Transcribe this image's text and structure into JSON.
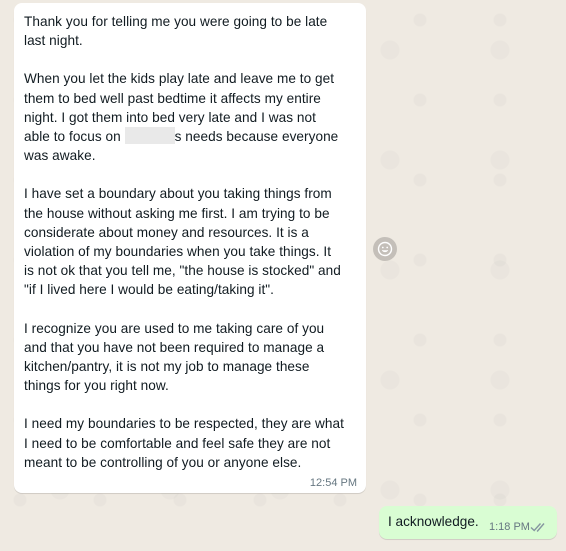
{
  "incoming_message": {
    "paragraphs": [
      "Thank you for telling me you were going to be late\nlast night.",
      "When you let the kids play late and leave me to get\nthem to bed well past bedtime it affects my entire\nnight.  I got them into bed very late and I was not",
      "I have set a boundary about you taking things from\nthe house without asking me first.  I am trying to be\nconsiderate about money and resources.  It is a\nviolation of my boundaries when you take things.  It\nis not ok that you tell me, \"the house is stocked\" and\n\"if I lived here I would be eating/taking it\".",
      "I recognize you are used to me taking care of you\nand that you have not been required to manage a\nkitchen/pantry, it is not my job to manage these\nthings for you right now.",
      "I need my boundaries to be respected, they are what\nI need to be comfortable and feel safe they are not\nmeant to be controlling of you or anyone else."
    ],
    "redacted_line_before": "able to focus on ",
    "redacted_line_after": "s needs because everyone\nwas awake.",
    "time": "12:54 PM"
  },
  "outgoing_message": {
    "text": "I acknowledge.",
    "time": "1:18 PM",
    "status_icon": "double-check-icon",
    "status_color": "#8696a0"
  },
  "react_button_icon": "smiley-icon",
  "colors": {
    "chat_background": "#efeae2",
    "incoming_bubble": "#ffffff",
    "outgoing_bubble": "#d9fdd3"
  }
}
